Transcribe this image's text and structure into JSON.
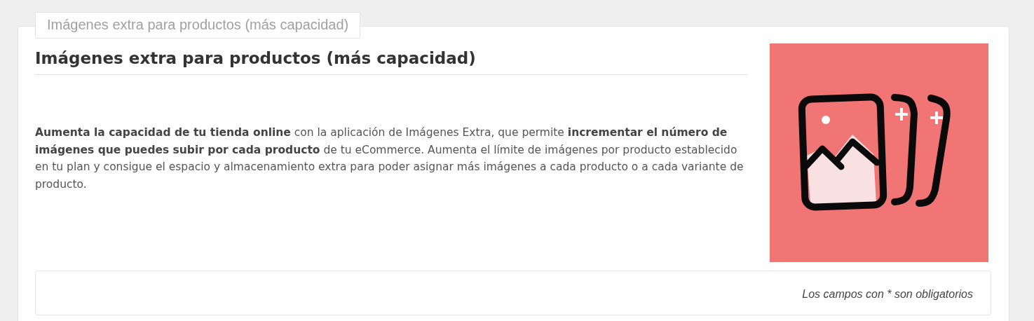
{
  "tab": {
    "label": "Imágenes extra para productos (más capacidad)"
  },
  "title": "Imágenes extra para productos (más capacidad)",
  "description": "**Aumenta la capacidad de tu tienda online** con la aplicación de Imágenes Extra, que permite **incrementar el número de imágenes que puedes subir por cada producto** de tu eCommerce. Aumenta el límite de imágenes por producto establecido en tu plan y consigue el espacio y almacenamiento extra para poder asignar más imágenes a cada producto o a cada variante de producto.",
  "form": {
    "required_note": "Los campos con * son obligatorios"
  }
}
